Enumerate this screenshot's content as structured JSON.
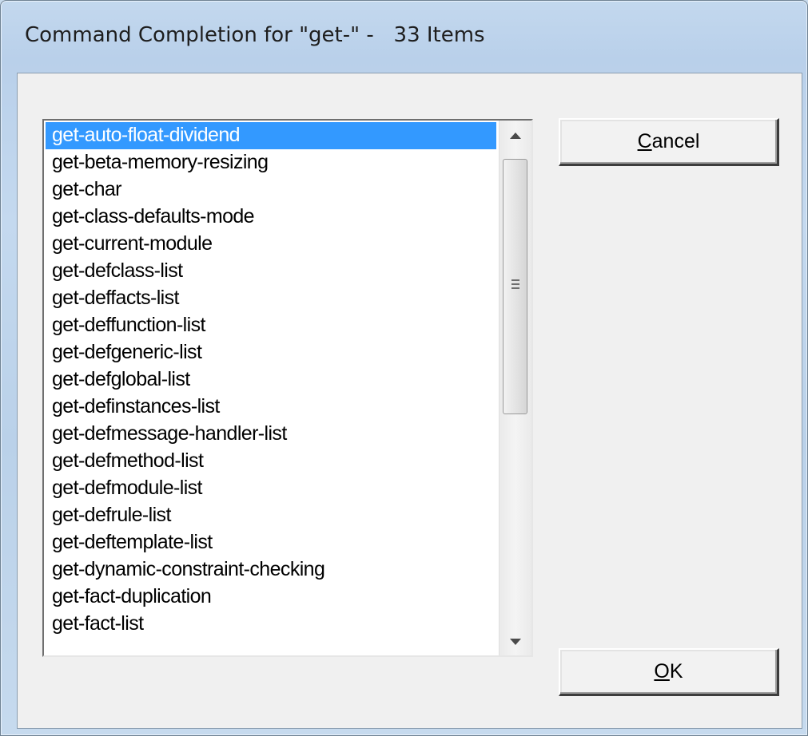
{
  "window": {
    "title": "Command Completion for \"get-\" -   33 Items"
  },
  "list": {
    "items": [
      "get-auto-float-dividend",
      "get-beta-memory-resizing",
      "get-char",
      "get-class-defaults-mode",
      "get-current-module",
      "get-defclass-list",
      "get-deffacts-list",
      "get-deffunction-list",
      "get-defgeneric-list",
      "get-defglobal-list",
      "get-definstances-list",
      "get-defmessage-handler-list",
      "get-defmethod-list",
      "get-defmodule-list",
      "get-defrule-list",
      "get-deftemplate-list",
      "get-dynamic-constraint-checking",
      "get-fact-duplication",
      "get-fact-list"
    ],
    "selected_index": 0,
    "scroll_up_icon": "arrow-up-icon",
    "scroll_down_icon": "arrow-down-icon",
    "thumb_grip_icon": "grip-icon"
  },
  "buttons": {
    "cancel": {
      "mnemonic": "C",
      "rest": "ancel"
    },
    "ok": {
      "mnemonic": "O",
      "rest": "K"
    }
  },
  "colors": {
    "selection": "#3399ff",
    "selection_text": "#ffffff",
    "window_frame": "#c3d8ee",
    "client_bg": "#f0f0f0"
  }
}
